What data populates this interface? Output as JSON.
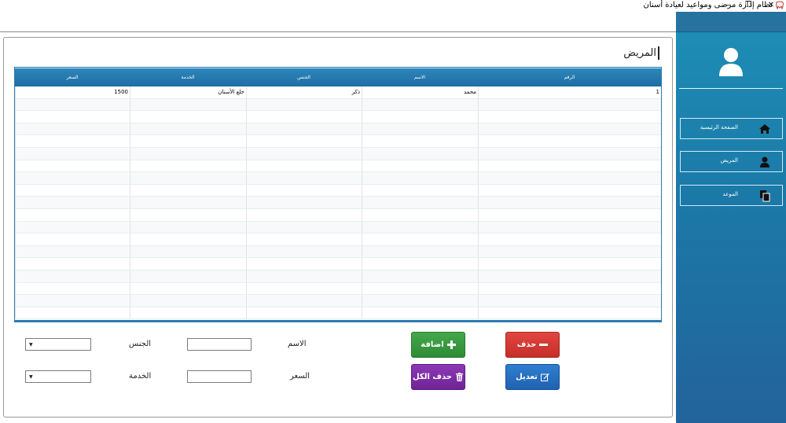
{
  "window": {
    "title": "نظام إدارة مرضى ومواعيد لعيادة أسنان",
    "minimize_glyph": "—",
    "maximize_glyph": "❐",
    "close_glyph": "✕"
  },
  "sidebar": {
    "items": [
      {
        "label": "الصفحة الرئيسية",
        "icon": "home-icon"
      },
      {
        "label": "المريض",
        "icon": "user-icon"
      },
      {
        "label": "الموعد",
        "icon": "copy-icon"
      }
    ]
  },
  "page": {
    "title": "المريض"
  },
  "table": {
    "columns": [
      "الرقم",
      "الاسم",
      "الجنس",
      "الخدمة",
      "السعر"
    ],
    "rows": [
      [
        "1",
        "محمد",
        "ذكر",
        "خلع الأسنان",
        "1500"
      ]
    ]
  },
  "form": {
    "name_label": "الاسم",
    "gender_label": "الجنس",
    "price_label": "السعر",
    "service_label": "الخدمة",
    "name_value": "",
    "price_value": "",
    "gender_value": "",
    "service_value": ""
  },
  "buttons": {
    "add": "اضافة",
    "delete": "حذف",
    "delete_all": "حذف الكل",
    "edit": "تعديل"
  },
  "colors": {
    "sidebar": "#1b79a8",
    "grid_header": "#1f6fa3",
    "add": "#2e8b36",
    "delete": "#c52f2a",
    "delete_all": "#6f2596",
    "edit": "#1f62b0"
  }
}
